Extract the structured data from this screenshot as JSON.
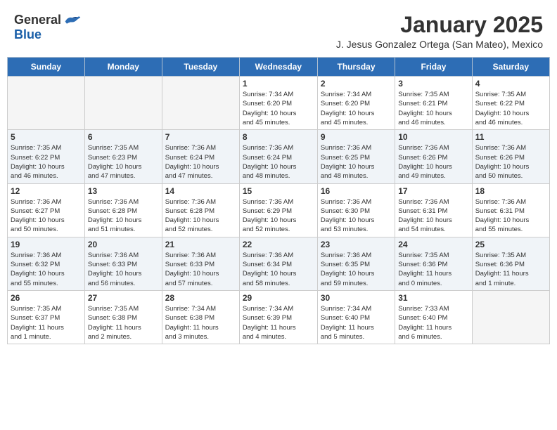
{
  "header": {
    "logo_general": "General",
    "logo_blue": "Blue",
    "month_title": "January 2025",
    "subtitle": "J. Jesus Gonzalez Ortega (San Mateo), Mexico"
  },
  "days_of_week": [
    "Sunday",
    "Monday",
    "Tuesday",
    "Wednesday",
    "Thursday",
    "Friday",
    "Saturday"
  ],
  "weeks": [
    {
      "shaded": false,
      "days": [
        {
          "num": "",
          "info": ""
        },
        {
          "num": "",
          "info": ""
        },
        {
          "num": "",
          "info": ""
        },
        {
          "num": "1",
          "info": "Sunrise: 7:34 AM\nSunset: 6:20 PM\nDaylight: 10 hours\nand 45 minutes."
        },
        {
          "num": "2",
          "info": "Sunrise: 7:34 AM\nSunset: 6:20 PM\nDaylight: 10 hours\nand 45 minutes."
        },
        {
          "num": "3",
          "info": "Sunrise: 7:35 AM\nSunset: 6:21 PM\nDaylight: 10 hours\nand 46 minutes."
        },
        {
          "num": "4",
          "info": "Sunrise: 7:35 AM\nSunset: 6:22 PM\nDaylight: 10 hours\nand 46 minutes."
        }
      ]
    },
    {
      "shaded": true,
      "days": [
        {
          "num": "5",
          "info": "Sunrise: 7:35 AM\nSunset: 6:22 PM\nDaylight: 10 hours\nand 46 minutes."
        },
        {
          "num": "6",
          "info": "Sunrise: 7:35 AM\nSunset: 6:23 PM\nDaylight: 10 hours\nand 47 minutes."
        },
        {
          "num": "7",
          "info": "Sunrise: 7:36 AM\nSunset: 6:24 PM\nDaylight: 10 hours\nand 47 minutes."
        },
        {
          "num": "8",
          "info": "Sunrise: 7:36 AM\nSunset: 6:24 PM\nDaylight: 10 hours\nand 48 minutes."
        },
        {
          "num": "9",
          "info": "Sunrise: 7:36 AM\nSunset: 6:25 PM\nDaylight: 10 hours\nand 48 minutes."
        },
        {
          "num": "10",
          "info": "Sunrise: 7:36 AM\nSunset: 6:26 PM\nDaylight: 10 hours\nand 49 minutes."
        },
        {
          "num": "11",
          "info": "Sunrise: 7:36 AM\nSunset: 6:26 PM\nDaylight: 10 hours\nand 50 minutes."
        }
      ]
    },
    {
      "shaded": false,
      "days": [
        {
          "num": "12",
          "info": "Sunrise: 7:36 AM\nSunset: 6:27 PM\nDaylight: 10 hours\nand 50 minutes."
        },
        {
          "num": "13",
          "info": "Sunrise: 7:36 AM\nSunset: 6:28 PM\nDaylight: 10 hours\nand 51 minutes."
        },
        {
          "num": "14",
          "info": "Sunrise: 7:36 AM\nSunset: 6:28 PM\nDaylight: 10 hours\nand 52 minutes."
        },
        {
          "num": "15",
          "info": "Sunrise: 7:36 AM\nSunset: 6:29 PM\nDaylight: 10 hours\nand 52 minutes."
        },
        {
          "num": "16",
          "info": "Sunrise: 7:36 AM\nSunset: 6:30 PM\nDaylight: 10 hours\nand 53 minutes."
        },
        {
          "num": "17",
          "info": "Sunrise: 7:36 AM\nSunset: 6:31 PM\nDaylight: 10 hours\nand 54 minutes."
        },
        {
          "num": "18",
          "info": "Sunrise: 7:36 AM\nSunset: 6:31 PM\nDaylight: 10 hours\nand 55 minutes."
        }
      ]
    },
    {
      "shaded": true,
      "days": [
        {
          "num": "19",
          "info": "Sunrise: 7:36 AM\nSunset: 6:32 PM\nDaylight: 10 hours\nand 55 minutes."
        },
        {
          "num": "20",
          "info": "Sunrise: 7:36 AM\nSunset: 6:33 PM\nDaylight: 10 hours\nand 56 minutes."
        },
        {
          "num": "21",
          "info": "Sunrise: 7:36 AM\nSunset: 6:33 PM\nDaylight: 10 hours\nand 57 minutes."
        },
        {
          "num": "22",
          "info": "Sunrise: 7:36 AM\nSunset: 6:34 PM\nDaylight: 10 hours\nand 58 minutes."
        },
        {
          "num": "23",
          "info": "Sunrise: 7:36 AM\nSunset: 6:35 PM\nDaylight: 10 hours\nand 59 minutes."
        },
        {
          "num": "24",
          "info": "Sunrise: 7:35 AM\nSunset: 6:36 PM\nDaylight: 11 hours\nand 0 minutes."
        },
        {
          "num": "25",
          "info": "Sunrise: 7:35 AM\nSunset: 6:36 PM\nDaylight: 11 hours\nand 1 minute."
        }
      ]
    },
    {
      "shaded": false,
      "days": [
        {
          "num": "26",
          "info": "Sunrise: 7:35 AM\nSunset: 6:37 PM\nDaylight: 11 hours\nand 1 minute."
        },
        {
          "num": "27",
          "info": "Sunrise: 7:35 AM\nSunset: 6:38 PM\nDaylight: 11 hours\nand 2 minutes."
        },
        {
          "num": "28",
          "info": "Sunrise: 7:34 AM\nSunset: 6:38 PM\nDaylight: 11 hours\nand 3 minutes."
        },
        {
          "num": "29",
          "info": "Sunrise: 7:34 AM\nSunset: 6:39 PM\nDaylight: 11 hours\nand 4 minutes."
        },
        {
          "num": "30",
          "info": "Sunrise: 7:34 AM\nSunset: 6:40 PM\nDaylight: 11 hours\nand 5 minutes."
        },
        {
          "num": "31",
          "info": "Sunrise: 7:33 AM\nSunset: 6:40 PM\nDaylight: 11 hours\nand 6 minutes."
        },
        {
          "num": "",
          "info": ""
        }
      ]
    }
  ]
}
